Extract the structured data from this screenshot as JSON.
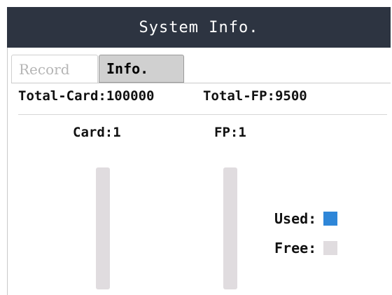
{
  "title": "System Info.",
  "tabs": [
    {
      "label": "Record",
      "active": false
    },
    {
      "label": "Info.",
      "active": true
    }
  ],
  "totals": {
    "card_label": "Total-Card:100000",
    "fp_label": "Total-FP:9500"
  },
  "counters": {
    "card_label": "Card:1",
    "fp_label": "FP:1"
  },
  "usage": {
    "card_used_fraction": 1e-05,
    "fp_used_fraction": 0.000105
  },
  "legend": {
    "used_label": "Used:",
    "free_label": "Free:",
    "used_color": "#2e86d8",
    "free_color": "#e0dcdf"
  },
  "colors": {
    "title_bar": "#2d3441",
    "tab_active_bg": "#d0d0d0"
  }
}
